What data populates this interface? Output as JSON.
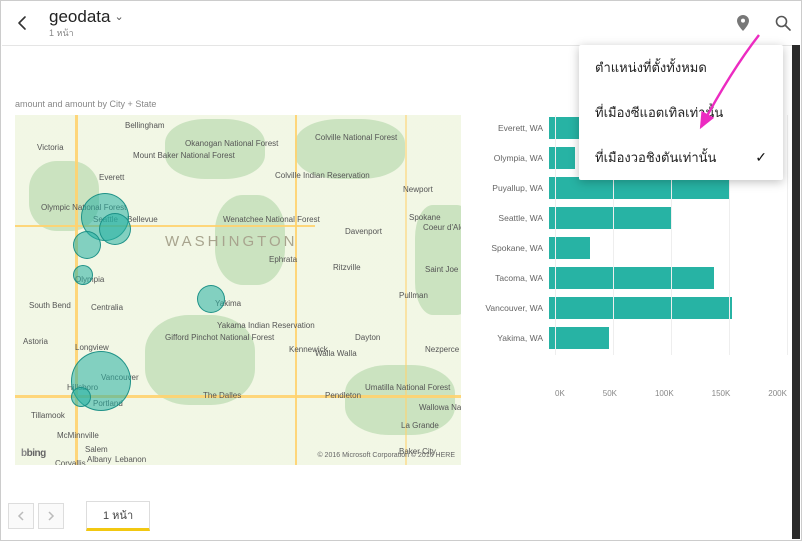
{
  "header": {
    "title": "geodata",
    "subtitle": "1 หน้า"
  },
  "menu": {
    "items": [
      {
        "label": "ตำแหน่งที่ตั้งทั้งหมด",
        "selected": false
      },
      {
        "label": "ที่เมืองซีแอตเทิลเท่านั้น",
        "selected": false
      },
      {
        "label": "ที่เมืองวอชิงตันเท่านั้น",
        "selected": true
      }
    ]
  },
  "map": {
    "title": "amount and amount by City + State",
    "big_state": "WASHINGTON",
    "labels": [
      "Bellingham",
      "Okanogan National Forest",
      "Colville National Forest",
      "Victoria",
      "Mount Baker National Forest",
      "Everett",
      "Olympic National Forest",
      "Newport",
      "Seattle",
      "Bellevue",
      "Olympia",
      "Ephrata",
      "Spokane",
      "South Bend",
      "Centralia",
      "Ritzville",
      "Yakima",
      "Kennewick",
      "Pullman",
      "Saint Joe National Forest",
      "Astoria",
      "Longview",
      "Gifford Pinchot National Forest",
      "Yakama Indian Reservation",
      "Dayton",
      "Walla Walla",
      "Tillamook",
      "Hillsboro",
      "Vancouver",
      "The Dalles",
      "Pendleton",
      "Umatilla National Forest",
      "Coeur d'Alene National Forest",
      "Wenatchee National Forest",
      "Portland",
      "Salem",
      "McMinnville",
      "La Grande",
      "Nezperce National Forest",
      "Colville Indian Reservation",
      "Corvallis",
      "Albany",
      "Lebanon",
      "Baker City",
      "Wallowa National Forest",
      "Davenport"
    ],
    "attribution_brand": "bing",
    "attribution_copy": "© 2016 Microsoft Corporation   © 2016 HERE",
    "bubbles": [
      {
        "x": 90,
        "y": 102,
        "r": 24
      },
      {
        "x": 100,
        "y": 114,
        "r": 16
      },
      {
        "x": 72,
        "y": 130,
        "r": 14
      },
      {
        "x": 68,
        "y": 160,
        "r": 10
      },
      {
        "x": 196,
        "y": 184,
        "r": 14
      },
      {
        "x": 86,
        "y": 266,
        "r": 30
      },
      {
        "x": 66,
        "y": 282,
        "r": 10
      }
    ]
  },
  "chart_data": {
    "type": "bar",
    "title": "amount by City + State",
    "orientation": "horizontal",
    "xlabel": "",
    "ylabel": "",
    "xlim": [
      0,
      200000
    ],
    "ticks": [
      "0K",
      "50K",
      "100K",
      "150K",
      "200K"
    ],
    "categories": [
      "Everett, WA",
      "Olympia, WA",
      "Puyallup, WA",
      "Seattle, WA",
      "Spokane, WA",
      "Tacoma, WA",
      "Vancouver, WA",
      "Yakima, WA"
    ],
    "values": [
      28000,
      22000,
      155000,
      105000,
      35000,
      142000,
      158000,
      52000
    ],
    "color": "#27b3a4"
  },
  "footer": {
    "page_tab": "1 หน้า"
  }
}
